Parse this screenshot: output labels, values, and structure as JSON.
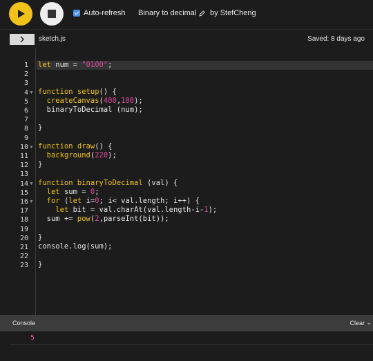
{
  "toolbar": {
    "autorefresh_label": "Auto-refresh",
    "autorefresh_checked": true,
    "project_name": "Binary to decimal",
    "author": "by StefCheng",
    "play_color": "#f2c21a"
  },
  "editor_header": {
    "file_name": "sketch.js",
    "saved_status": "Saved: 8 days ago"
  },
  "code": {
    "active_line": 1,
    "line_numbers": [
      "1",
      "2",
      "3",
      "4",
      "5",
      "6",
      "7",
      "8",
      "9",
      "10",
      "11",
      "12",
      "13",
      "14",
      "15",
      "16",
      "17",
      "18",
      "19",
      "20",
      "21",
      "22",
      "23"
    ],
    "fold_lines": [
      4,
      10,
      14,
      16
    ]
  },
  "console": {
    "title": "Console",
    "clear_label": "Clear",
    "output_value": "5"
  }
}
